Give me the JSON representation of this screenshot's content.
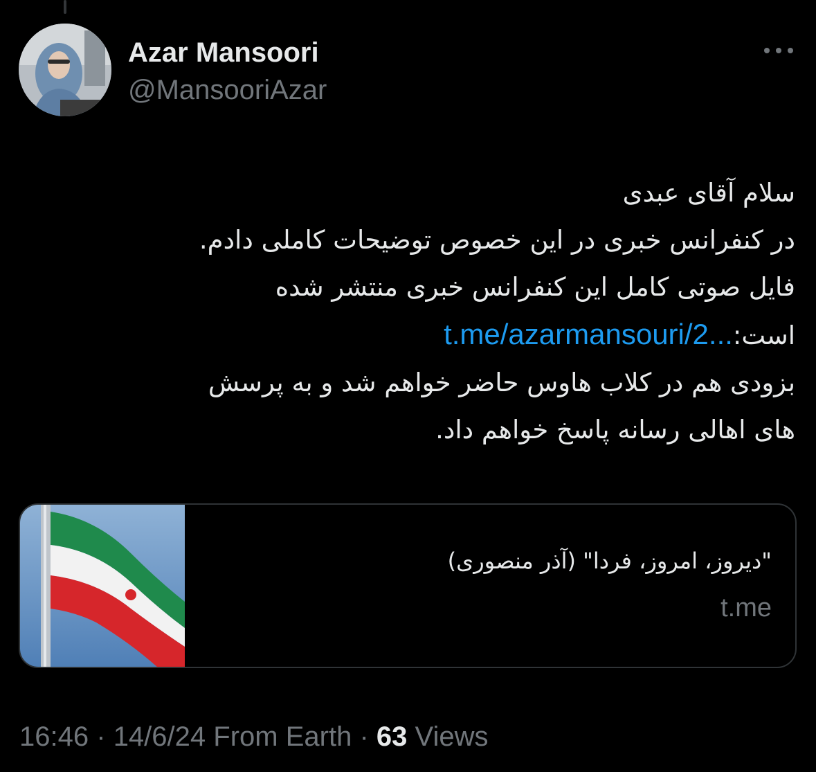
{
  "colors": {
    "background": "#000000",
    "text_primary": "#e7e9ea",
    "text_secondary": "#71767b",
    "link": "#1d9bf0",
    "card_border": "#2f3336"
  },
  "author": {
    "display_name": "Azar Mansoori",
    "handle": "@MansooriAzar",
    "avatar_icon": "user-photo-avatar"
  },
  "more_menu_icon": "more-dots-icon",
  "tweet": {
    "lines": {
      "l1": "سلام آقای عبدی",
      "l2": "در کنفرانس خبری در این خصوص توضیحات کاملی دادم.",
      "l3": "فایل صوتی کامل این کنفرانس خبری منتشر شده",
      "l4_prefix": "است:",
      "l4_link": "t.me/azarmansouri/2...",
      "l5": "بزودی هم در کلاب هاوس حاضر خواهم شد و به پرسش",
      "l6": "های اهالی رسانه پاسخ خواهم داد."
    }
  },
  "link_card": {
    "title": "\"دیروز، امروز، فردا\" (آذر منصوری)",
    "domain": "t.me",
    "thumbnail_icon": "iran-flag-image"
  },
  "meta": {
    "time": "16:46",
    "sep1": "·",
    "date": "14/6/24",
    "source": "From Earth",
    "sep2": "·",
    "views_count": "63",
    "views_label": "Views"
  }
}
